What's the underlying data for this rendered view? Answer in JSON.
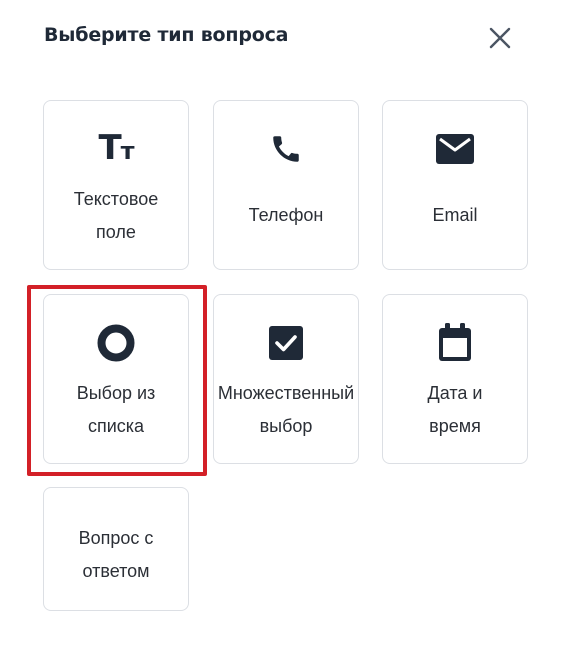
{
  "dialog": {
    "title": "Выберите тип вопроса",
    "close_icon": "close-icon"
  },
  "question_types": [
    {
      "icon": "text-field-icon",
      "line1": "Текстовое",
      "line2": "поле"
    },
    {
      "icon": "phone-icon",
      "line1": "Телефон"
    },
    {
      "icon": "email-icon",
      "line1": "Email"
    },
    {
      "icon": "radio-choice-icon",
      "line1": "Выбор из",
      "line2": "списка",
      "selected": true
    },
    {
      "icon": "checkbox-icon",
      "line1": "Множественный",
      "line2": "выбор"
    },
    {
      "icon": "calendar-icon",
      "line1": "Дата и",
      "line2": "время"
    },
    {
      "icon": "",
      "line1": "Вопрос с",
      "line2": "ответом"
    }
  ],
  "icon_glyphs": {
    "text_field": "Tт"
  },
  "colors": {
    "text": "#1f2937",
    "icon": "#1f2937",
    "card_border": "#dcdfe4",
    "highlight": "#d32027"
  }
}
